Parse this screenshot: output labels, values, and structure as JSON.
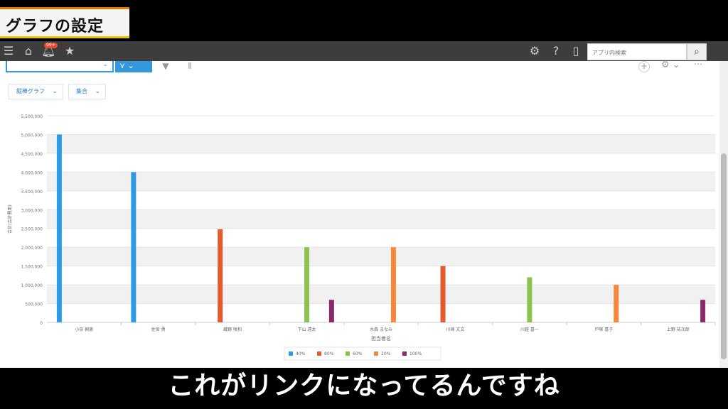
{
  "banner": {
    "title": "グラフの設定"
  },
  "topbar": {
    "menu_icon": "hamburger-icon",
    "home_icon": "home-icon",
    "bell_icon": "bell-icon",
    "bell_badge": "99+",
    "star_icon": "star-icon",
    "gear_icon": "gear-icon",
    "help_icon": "help-icon",
    "mobile_icon": "mobile-icon",
    "search_placeholder": "アプリ内検索",
    "search_icon": "search-icon"
  },
  "toolbar": {
    "graph_icon": "line-graph-icon",
    "filter_icon": "filter-icon",
    "columns_icon": "columns-icon"
  },
  "chart_options": {
    "chart_type": "縦棒グラフ",
    "aggregation": "集合"
  },
  "chart_data": {
    "type": "bar",
    "xlabel": "担当者名",
    "ylabel": "合計(合計費用)",
    "ylim": [
      0,
      5500000
    ],
    "yticks": [
      "0",
      "500,000",
      "1,000,000",
      "1,500,000",
      "2,000,000",
      "2,500,000",
      "3,000,000",
      "3,500,000",
      "4,000,000",
      "4,500,000",
      "5,000,000",
      "5,500,000"
    ],
    "categories": [
      "小奈 桐恵",
      "佐宮 勇",
      "蔵野 咲和",
      "下山 遠太",
      "水森 まなみ",
      "川崎 文文",
      "川越 喜一",
      "戸塚 喜子",
      "上野 祐次郎"
    ],
    "series": [
      {
        "name": "40%",
        "color": "#2e9be6",
        "values": [
          5000000,
          4000000,
          null,
          null,
          null,
          null,
          null,
          null,
          null
        ]
      },
      {
        "name": "80%",
        "color": "#e35b2d",
        "values": [
          null,
          null,
          2480000,
          null,
          null,
          1500000,
          null,
          null,
          null
        ]
      },
      {
        "name": "60%",
        "color": "#8cc350",
        "values": [
          null,
          null,
          null,
          2000000,
          null,
          null,
          1200000,
          null,
          null
        ]
      },
      {
        "name": "20%",
        "color": "#f5883a",
        "values": [
          null,
          null,
          null,
          null,
          2000000,
          null,
          null,
          1000000,
          null
        ]
      },
      {
        "name": "100%",
        "color": "#8b2a6b",
        "values": [
          null,
          null,
          null,
          600000,
          null,
          null,
          null,
          null,
          600000
        ]
      }
    ],
    "legend_position": "bottom",
    "grid": true
  },
  "subtitle": "これがリンクになってるんですね"
}
